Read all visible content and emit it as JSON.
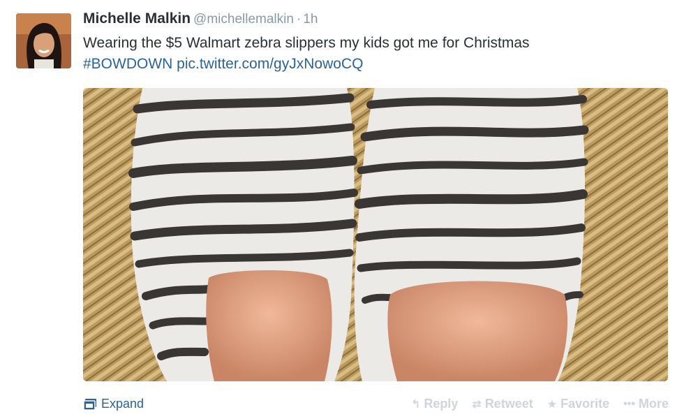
{
  "tweet": {
    "fullname": "Michelle Malkin",
    "username": "@michellemalkin",
    "separator": "·",
    "time": "1h",
    "text_before": "Wearing the $5 Walmart zebra slippers my kids got me for Christmas",
    "hashtag": "#BOWDOWN",
    "link": "pic.twitter.com/gyJxNowoCQ"
  },
  "footer": {
    "expand_label": "Expand",
    "reply_label": "Reply",
    "retweet_label": "Retweet",
    "favorite_label": "Favorite",
    "more_label": "More"
  },
  "icons": {
    "expand": "media-expand-icon",
    "reply": "reply-arrow-icon",
    "retweet": "retweet-icon",
    "favorite": "star-icon",
    "more": "ellipsis-icon"
  },
  "colors": {
    "link": "#2a6496",
    "name": "#292f33",
    "muted": "#8899a6",
    "action": "#cfd5da"
  }
}
